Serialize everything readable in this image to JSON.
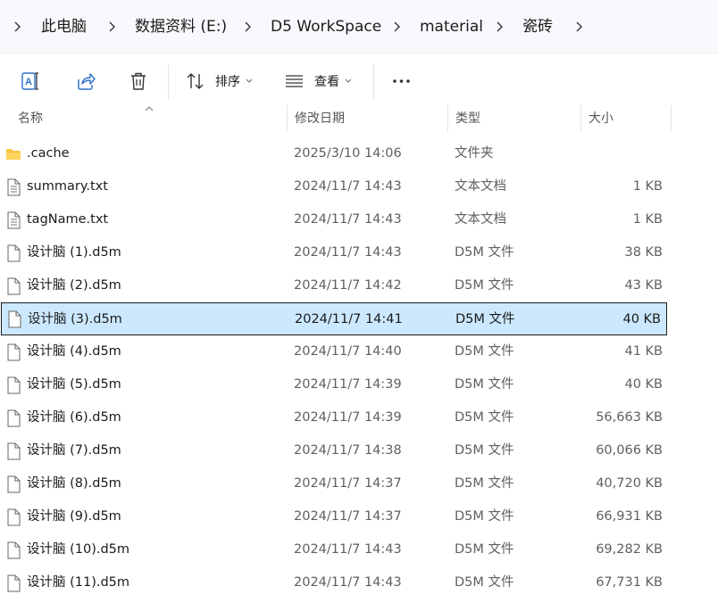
{
  "breadcrumb": {
    "items": [
      "此电脑",
      "数据资料 (E:)",
      "D5 WorkSpace",
      "material",
      "瓷砖"
    ]
  },
  "toolbar": {
    "sort_label": "排序",
    "view_label": "查看"
  },
  "columns": {
    "name": "名称",
    "date": "修改日期",
    "type": "类型",
    "size": "大小"
  },
  "files": [
    {
      "name": ".cache",
      "date": "2025/3/10 14:06",
      "type": "文件夹",
      "size": "",
      "icon": "folder-icon"
    },
    {
      "name": "summary.txt",
      "date": "2024/11/7 14:43",
      "type": "文本文档",
      "size": "1 KB",
      "icon": "text-file-icon"
    },
    {
      "name": "tagName.txt",
      "date": "2024/11/7 14:43",
      "type": "文本文档",
      "size": "1 KB",
      "icon": "text-file-icon"
    },
    {
      "name": "设计脑 (1).d5m",
      "date": "2024/11/7 14:43",
      "type": "D5M 文件",
      "size": "38 KB",
      "icon": "file-icon"
    },
    {
      "name": "设计脑 (2).d5m",
      "date": "2024/11/7 14:42",
      "type": "D5M 文件",
      "size": "43 KB",
      "icon": "file-icon"
    },
    {
      "name": "设计脑 (3).d5m",
      "date": "2024/11/7 14:41",
      "type": "D5M 文件",
      "size": "40 KB",
      "icon": "file-icon",
      "selected": true
    },
    {
      "name": "设计脑 (4).d5m",
      "date": "2024/11/7 14:40",
      "type": "D5M 文件",
      "size": "41 KB",
      "icon": "file-icon"
    },
    {
      "name": "设计脑 (5).d5m",
      "date": "2024/11/7 14:39",
      "type": "D5M 文件",
      "size": "40 KB",
      "icon": "file-icon"
    },
    {
      "name": "设计脑 (6).d5m",
      "date": "2024/11/7 14:39",
      "type": "D5M 文件",
      "size": "56,663 KB",
      "icon": "file-icon"
    },
    {
      "name": "设计脑 (7).d5m",
      "date": "2024/11/7 14:38",
      "type": "D5M 文件",
      "size": "60,066 KB",
      "icon": "file-icon"
    },
    {
      "name": "设计脑 (8).d5m",
      "date": "2024/11/7 14:37",
      "type": "D5M 文件",
      "size": "40,720 KB",
      "icon": "file-icon"
    },
    {
      "name": "设计脑 (9).d5m",
      "date": "2024/11/7 14:37",
      "type": "D5M 文件",
      "size": "66,931 KB",
      "icon": "file-icon"
    },
    {
      "name": "设计脑 (10).d5m",
      "date": "2024/11/7 14:43",
      "type": "D5M 文件",
      "size": "69,282 KB",
      "icon": "file-icon"
    },
    {
      "name": "设计脑 (11).d5m",
      "date": "2024/11/7 14:43",
      "type": "D5M 文件",
      "size": "67,731 KB",
      "icon": "file-icon"
    }
  ],
  "colors": {
    "selection_bg": "#cce8ff",
    "folder": "#f8c642",
    "accent": "#2b6fc7"
  }
}
